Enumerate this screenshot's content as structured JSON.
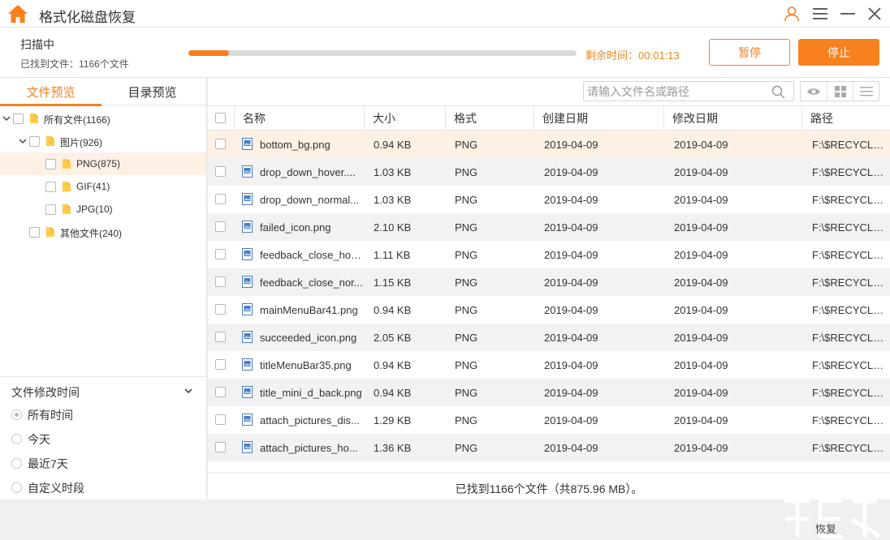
{
  "app": {
    "title": "格式化磁盘恢复"
  },
  "colors": {
    "accent": "#f7811e",
    "highlight_row": "#fdf0e4",
    "alt_row": "#f2f2f2"
  },
  "icons": [
    "home-icon",
    "user-icon",
    "menu-icon",
    "minimize-icon",
    "close-icon",
    "folder-icon",
    "caret-down-icon",
    "caret-right-icon",
    "image-file-icon",
    "search-icon",
    "eye-icon",
    "grid-view-icon",
    "list-view-icon",
    "chevron-down-icon"
  ],
  "scan": {
    "title": "扫描中",
    "found_label": "已找到文件：1166个文件",
    "progress_percent": 10.5,
    "remaining_label": "剩余时间：",
    "remaining_time": "00:01:13",
    "pause_label": "暂停",
    "stop_label": "停止"
  },
  "left": {
    "tabs": [
      {
        "label": "文件预览",
        "active": true
      },
      {
        "label": "目录预览",
        "active": false
      }
    ],
    "tree": [
      {
        "label": "所有文件(1166)",
        "level": 0,
        "caret": "down",
        "folder": true
      },
      {
        "label": "图片(926)",
        "level": 1,
        "caret": "down",
        "folder": true
      },
      {
        "label": "PNG(875)",
        "level": 2,
        "caret": "",
        "folder": true,
        "selected": true
      },
      {
        "label": "GIF(41)",
        "level": 2,
        "caret": "",
        "folder": true
      },
      {
        "label": "JPG(10)",
        "level": 2,
        "caret": "",
        "folder": true
      },
      {
        "label": "其他文件(240)",
        "level": 1,
        "caret": "",
        "folder": true
      }
    ],
    "filter": {
      "title": "文件修改时间",
      "options": [
        {
          "label": "所有时间",
          "checked": true
        },
        {
          "label": "今天",
          "checked": false
        },
        {
          "label": "最近7天",
          "checked": false
        },
        {
          "label": "自定义时段",
          "checked": false
        }
      ]
    }
  },
  "search": {
    "placeholder": "请输入文件名或路径",
    "value": ""
  },
  "table": {
    "columns": [
      "名称",
      "大小",
      "格式",
      "创建日期",
      "修改日期",
      "路径"
    ],
    "rows": [
      {
        "name": "bottom_bg.png",
        "size": "0.94 KB",
        "format": "PNG",
        "created": "2019-04-09",
        "modified": "2019-04-09",
        "path": "F:\\$RECYCLE...."
      },
      {
        "name": "drop_down_hover....",
        "size": "1.03 KB",
        "format": "PNG",
        "created": "2019-04-09",
        "modified": "2019-04-09",
        "path": "F:\\$RECYCLE...."
      },
      {
        "name": "drop_down_normal...",
        "size": "1.03 KB",
        "format": "PNG",
        "created": "2019-04-09",
        "modified": "2019-04-09",
        "path": "F:\\$RECYCLE...."
      },
      {
        "name": "failed_icon.png",
        "size": "2.10 KB",
        "format": "PNG",
        "created": "2019-04-09",
        "modified": "2019-04-09",
        "path": "F:\\$RECYCLE...."
      },
      {
        "name": "feedback_close_hov...",
        "size": "1.11 KB",
        "format": "PNG",
        "created": "2019-04-09",
        "modified": "2019-04-09",
        "path": "F:\\$RECYCLE...."
      },
      {
        "name": "feedback_close_nor...",
        "size": "1.15 KB",
        "format": "PNG",
        "created": "2019-04-09",
        "modified": "2019-04-09",
        "path": "F:\\$RECYCLE...."
      },
      {
        "name": "mainMenuBar41.png",
        "size": "0.94 KB",
        "format": "PNG",
        "created": "2019-04-09",
        "modified": "2019-04-09",
        "path": "F:\\$RECYCLE...."
      },
      {
        "name": "succeeded_icon.png",
        "size": "2.05 KB",
        "format": "PNG",
        "created": "2019-04-09",
        "modified": "2019-04-09",
        "path": "F:\\$RECYCLE...."
      },
      {
        "name": "titleMenuBar35.png",
        "size": "0.94 KB",
        "format": "PNG",
        "created": "2019-04-09",
        "modified": "2019-04-09",
        "path": "F:\\$RECYCLE...."
      },
      {
        "name": "title_mini_d_back.png",
        "size": "0.94 KB",
        "format": "PNG",
        "created": "2019-04-09",
        "modified": "2019-04-09",
        "path": "F:\\$RECYCLE...."
      },
      {
        "name": "attach_pictures_dis...",
        "size": "1.29 KB",
        "format": "PNG",
        "created": "2019-04-09",
        "modified": "2019-04-09",
        "path": "F:\\$RECYCLE...."
      },
      {
        "name": "attach_pictures_ho...",
        "size": "1.36 KB",
        "format": "PNG",
        "created": "2019-04-09",
        "modified": "2019-04-09",
        "path": "F:\\$RECYCLE...."
      }
    ],
    "footer": "已找到1166个文件（共875.96 MB）。"
  },
  "watermark": {
    "text": "恢复"
  }
}
